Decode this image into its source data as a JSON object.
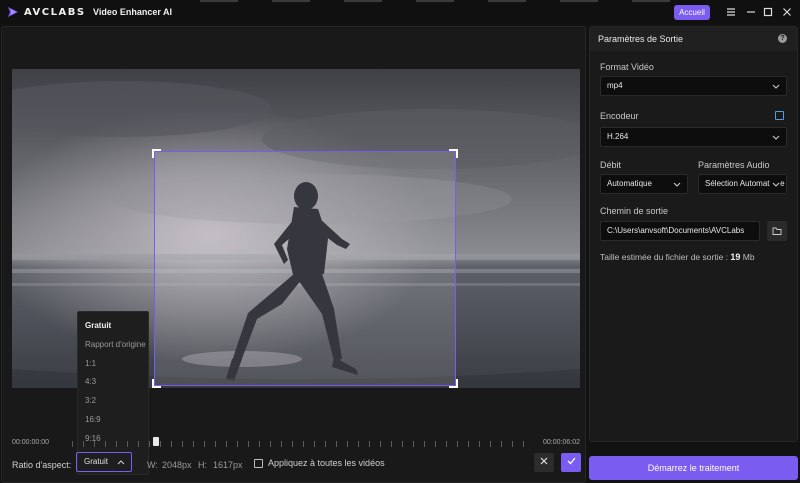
{
  "titlebar": {
    "logo_text": "AVCLABS",
    "app_name": "Video Enhancer AI",
    "home_button": "Accueil",
    "menu_icon": "menu-icon",
    "minimize_icon": "minimize-icon",
    "maximize_icon": "maximize-icon",
    "close_icon": "close-icon"
  },
  "editor": {
    "aspect_options": [
      "Gratuit",
      "Rapport d'origine",
      "1:1",
      "4:3",
      "3:2",
      "16:9",
      "9:16"
    ],
    "selected_aspect_index": 0,
    "timeline": {
      "start": "00:00:00:00",
      "end": "00:00:06:02"
    },
    "bottom": {
      "ratio_label": "Ratio d'aspect:",
      "ratio_value": "Gratuit",
      "width_label": "W:",
      "width_value": "2048px",
      "height_label": "H:",
      "height_value": "1617px",
      "apply_all_label": "Appliquez à toutes les vidéos",
      "apply_all_checked": false
    }
  },
  "panel": {
    "title": "Paramètres de Sortie",
    "format_label": "Format Vidéo",
    "format_value": "mp4",
    "encoder_label": "Encodeur",
    "encoder_value": "H.264",
    "bitrate_label": "Débit",
    "bitrate_value": "Automatique",
    "audio_label": "Paramètres Audio",
    "audio_value": "Sélection Automatique",
    "path_label": "Chemin de sortie",
    "path_value": "C:\\Users\\anvsoft\\Documents\\AVCLabs",
    "size_prefix": "Taille estimée du fichier de sortie :",
    "size_value": "19",
    "size_unit": "Mb"
  },
  "start_button": "Démarrez le traitement",
  "colors": {
    "accent": "#7b5cf0",
    "background": "#121212",
    "panel": "#1a1a1a"
  }
}
